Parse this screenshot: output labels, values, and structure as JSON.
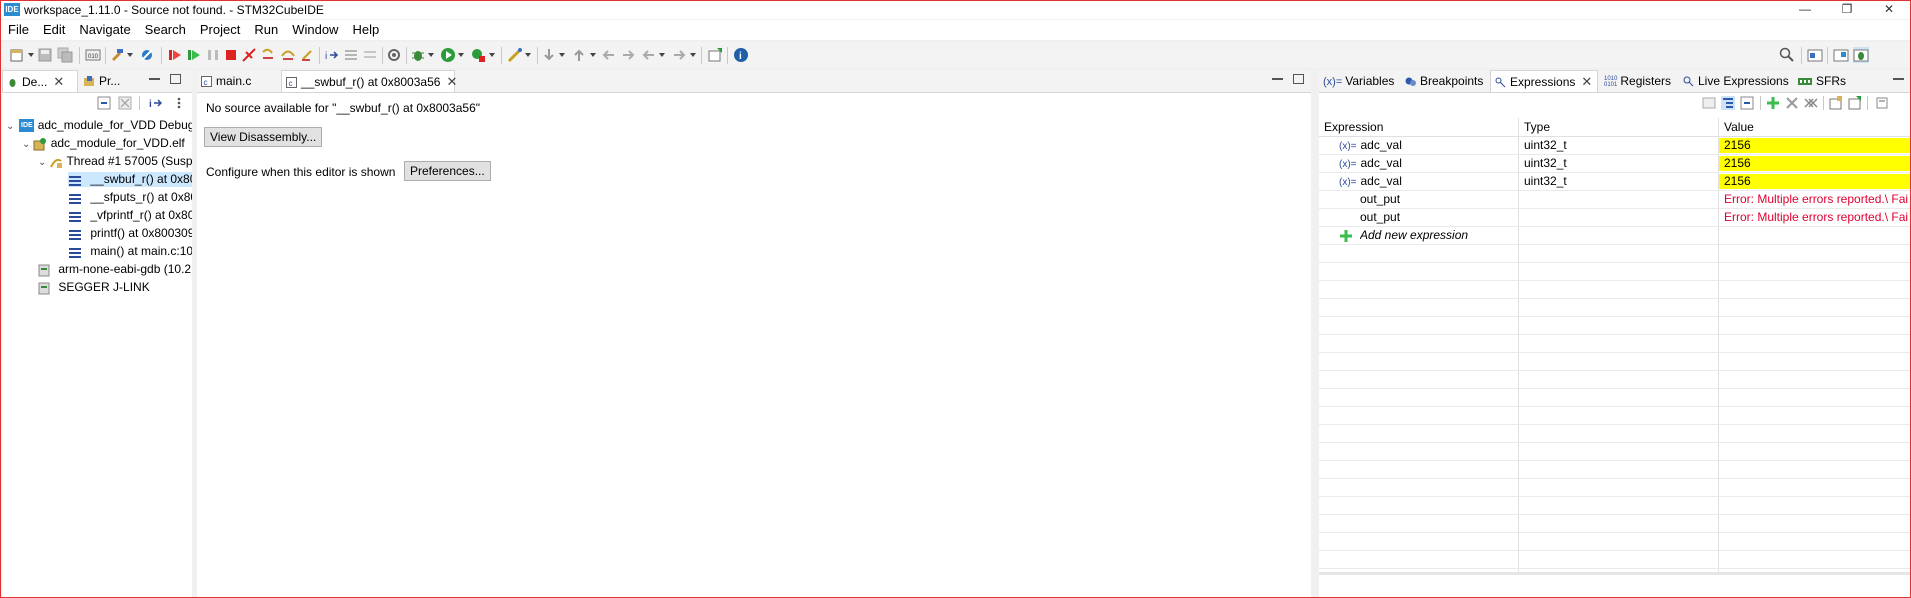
{
  "window": {
    "app_icon_text": "IDE",
    "title": "workspace_1.11.0 - Source not found. - STM32CubeIDE",
    "controls": [
      "—",
      "❐",
      "✕"
    ]
  },
  "menu": [
    "File",
    "Edit",
    "Navigate",
    "Search",
    "Project",
    "Run",
    "Window",
    "Help"
  ],
  "left_panel": {
    "tabs": [
      {
        "label": "De...",
        "icon": "debug-icon"
      },
      {
        "label": "Pr...",
        "icon": "project-explorer-icon"
      }
    ],
    "tree": [
      {
        "label": "adc_module_for_VDD Debug",
        "icon": "ide-launch-icon",
        "level": 0,
        "expanded": true
      },
      {
        "label": "adc_module_for_VDD.elf",
        "icon": "elf-process-icon",
        "level": 1,
        "expanded": true
      },
      {
        "label": "Thread #1 57005 (Susp",
        "icon": "thread-icon",
        "level": 2,
        "expanded": true
      },
      {
        "label": "__swbuf_r() at 0x800",
        "icon": "stack-frame-icon",
        "level": 3,
        "selected": true
      },
      {
        "label": "__sfputs_r() at 0x800",
        "icon": "stack-frame-icon",
        "level": 3
      },
      {
        "label": "_vfprintf_r() at 0x800",
        "icon": "stack-frame-icon",
        "level": 3
      },
      {
        "label": "printf() at 0x800309",
        "icon": "stack-frame-icon",
        "level": 3
      },
      {
        "label": "main() at main.c:10",
        "icon": "stack-frame-icon",
        "level": 3
      },
      {
        "label": "arm-none-eabi-gdb (10.2",
        "icon": "gdb-icon",
        "level": 1
      },
      {
        "label": "SEGGER J-LINK",
        "icon": "gdb-icon",
        "level": 1
      }
    ]
  },
  "editor": {
    "tabs": [
      {
        "label": "main.c",
        "icon": "c-file-icon",
        "active": false
      },
      {
        "label": "__swbuf_r() at 0x8003a56",
        "icon": "c-file-icon",
        "active": true
      }
    ],
    "no_source_text": "No source available for \"__swbuf_r() at 0x8003a56\"",
    "view_disassembly_label": "View Disassembly...",
    "configure_text": "Configure when this editor is shown",
    "preferences_label": "Preferences..."
  },
  "right_panel": {
    "tabs": [
      {
        "label": "Variables",
        "icon": "variables-icon"
      },
      {
        "label": "Breakpoints",
        "icon": "breakpoints-icon"
      },
      {
        "label": "Expressions",
        "icon": "expressions-icon",
        "active": true
      },
      {
        "label": "Registers",
        "icon": "registers-icon"
      },
      {
        "label": "Live Expressions",
        "icon": "live-expressions-icon"
      },
      {
        "label": "SFRs",
        "icon": "sfrs-icon"
      }
    ],
    "columns": [
      "Expression",
      "Type",
      "Value"
    ],
    "rows": [
      {
        "expression": "adc_val",
        "type": "uint32_t",
        "value": "2156",
        "icon": "(x)=",
        "highlight": true
      },
      {
        "expression": "adc_val",
        "type": "uint32_t",
        "value": "2156",
        "icon": "(x)=",
        "highlight": true
      },
      {
        "expression": "adc_val",
        "type": "uint32_t",
        "value": "2156",
        "icon": "(x)=",
        "highlight": true
      },
      {
        "expression": "out_put",
        "type": "",
        "value": "Error: Multiple errors reported.\\ Fai",
        "icon": "",
        "error": true
      },
      {
        "expression": "out_put",
        "type": "",
        "value": "Error: Multiple errors reported.\\ Fai",
        "icon": "",
        "error": true
      }
    ],
    "add_new_label": "Add new expression"
  },
  "colors": {
    "highlight": "#ffff00",
    "error_text": "#e00030",
    "selection": "#cce8ff",
    "window_border": "#dd3333"
  }
}
